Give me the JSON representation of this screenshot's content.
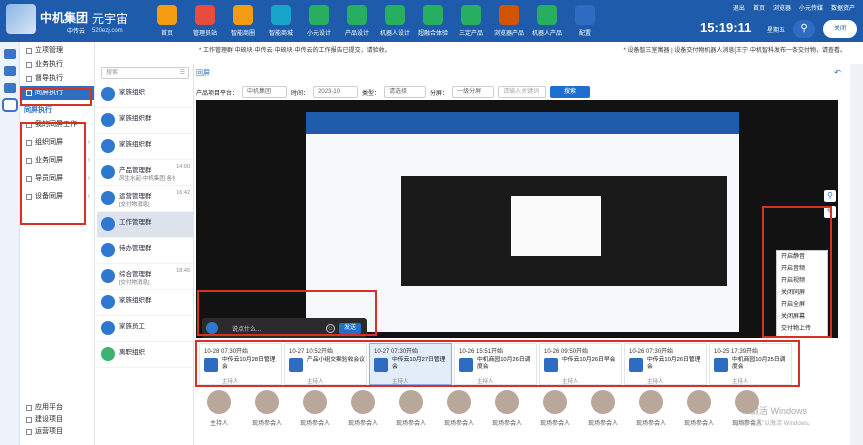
{
  "header": {
    "brand": "中机集团",
    "brand_sub": "中传云",
    "product": "元宇宙",
    "product_url": "520ezj.com",
    "nav": [
      {
        "label": "首页",
        "color": "#f39c12"
      },
      {
        "label": "管理员站",
        "color": "#e74c3c"
      },
      {
        "label": "智能商圈",
        "color": "#f39c12"
      },
      {
        "label": "智能商城",
        "color": "#16a5c9"
      },
      {
        "label": "小元设计",
        "color": "#27ae60"
      },
      {
        "label": "产品设计",
        "color": "#27ae60"
      },
      {
        "label": "机器人设计",
        "color": "#27ae60"
      },
      {
        "label": "超融合体验",
        "color": "#27ae60"
      },
      {
        "label": "三定产品",
        "color": "#27ae60"
      },
      {
        "label": "浏览器产品",
        "color": "#d35400"
      },
      {
        "label": "机器人产品",
        "color": "#27ae60"
      },
      {
        "label": "配置",
        "color": "#2d6cc0"
      }
    ],
    "links": [
      "退出",
      "首页",
      "浏览器",
      "小元传媒",
      "数据资产"
    ],
    "clock": "15:19:11",
    "weekday": "星期五",
    "close_label": "关闭"
  },
  "menu": {
    "items": [
      "立项管理",
      "业务执行",
      "督导执行",
      "同屏执行"
    ],
    "section": "同屏执行",
    "sub_items": [
      "我的同屏工作",
      "组织同屏",
      "业务同屏",
      "导员同屏",
      "设备同屏"
    ],
    "bottom_items": [
      "应用平台",
      "建设项目",
      "运营项目"
    ]
  },
  "breadcrumb": "* 工作管理群 中硫块·中传云·中硫块·中传云的工作报告已提交，请验收。",
  "breadcrumb2": "* 设备智三室寓器 | 设备交付物机器人消息[王宁·中机智科发布一条交付物，请查看。",
  "conversations": {
    "search_placeholder": "搜索",
    "items": [
      {
        "name": "家族组织",
        "sub": "",
        "time": ""
      },
      {
        "name": "家族组织群",
        "sub": "",
        "time": ""
      },
      {
        "name": "家族组织群",
        "sub": "",
        "time": ""
      },
      {
        "name": "产品管理群",
        "sub": "风生水起-中机集团·各位...",
        "time": "14:00"
      },
      {
        "name": "运营管理群",
        "sub": "[交付物消息]",
        "time": "16:42"
      },
      {
        "name": "工作管理群",
        "sub": "",
        "time": ""
      },
      {
        "name": "待办管理群",
        "sub": "",
        "time": ""
      },
      {
        "name": "综合管理群",
        "sub": "[交付物消息]",
        "time": "18:45"
      },
      {
        "name": "家族组织群",
        "sub": "",
        "time": ""
      },
      {
        "name": "家族员工",
        "sub": "",
        "time": ""
      },
      {
        "name": "离职组织",
        "sub": "",
        "time": ""
      }
    ]
  },
  "main": {
    "title": "回屏",
    "filter": {
      "platform_label": "产品项目平台：",
      "platform_value": "中机集团",
      "time_label": "时间：",
      "time_value": "2023-10",
      "type_label": "类型：",
      "type_value": "请选择",
      "score_label": "分屏：",
      "score_value": "一级分屏",
      "keyword_placeholder": "请输入关键词",
      "query_label": "搜索"
    },
    "context_menu": [
      "开启静音",
      "开启音频",
      "开启视频",
      "关闭同屏",
      "开启全屏",
      "关闭屏幕",
      "交付物上传",
      "屏幕编辑"
    ],
    "chat_placeholder": "说点什么...",
    "send_label": "发送",
    "meetings": [
      {
        "time": "10-28 07:30开始",
        "name": "中传云10月28日管理会",
        "host": "主持人"
      },
      {
        "time": "10-27 10:52开始",
        "name": "产品小组交案验收会议",
        "host": "主持人"
      },
      {
        "time": "10-27 07:30开始",
        "name": "中传云10月27日管理会",
        "host": "主持人"
      },
      {
        "time": "10-26 15:51开始",
        "name": "中机商园10月26日调度会",
        "host": "主持人"
      },
      {
        "time": "10-26 09:50开始",
        "name": "中传云10月26日早会",
        "host": "主持人"
      },
      {
        "time": "10-26 07:30开始",
        "name": "中传云10月26日管理会",
        "host": "主持人"
      },
      {
        "time": "10-25 17:39开始",
        "name": "中机商园10月25日调度会",
        "host": "主持人"
      }
    ],
    "participants": [
      "主持人",
      "现场参会人",
      "现场参会人",
      "现场参会人",
      "现场参会人",
      "现场参会人",
      "现场参会人",
      "现场参会人",
      "现场参会人",
      "现场参会人",
      "现场参会人",
      "现场参会人"
    ]
  },
  "watermark": {
    "line1": "激活 Windows",
    "line2": "转到“设置”以激活 Windows。"
  }
}
